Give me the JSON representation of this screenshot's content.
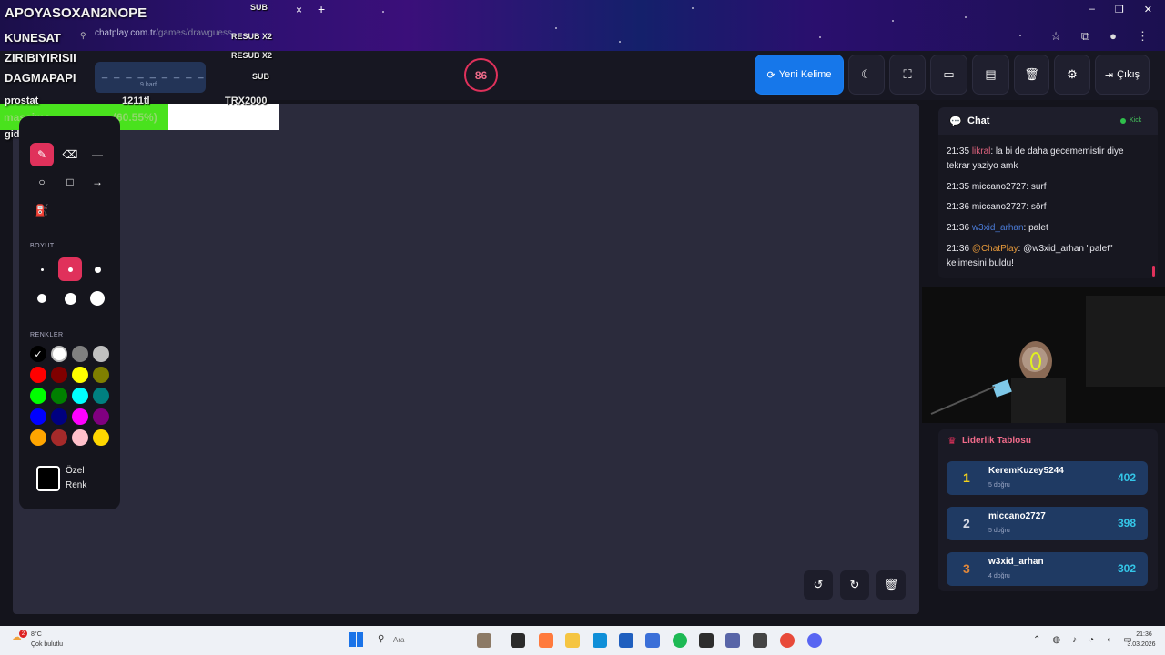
{
  "browser": {
    "tab_close": "×",
    "tab_new": "+",
    "url_domain": "chatplay.com.tr",
    "url_path": "/games/drawguess",
    "window_controls": [
      "–",
      "❐",
      "✕"
    ]
  },
  "overlay": {
    "names": [
      "APOYASOXAN2NOPE",
      "KUNESAT",
      "ZIRIBIYIRISII",
      "DAGMAPAPI",
      "prostat",
      "gidicem"
    ],
    "tags": [
      "SUB",
      "RESUB X2",
      "RESUB X2",
      "SUB",
      "1211tl",
      "TRX2000"
    ],
    "bar_word": "masajma",
    "bar_percent": "(60.55%)",
    "bar_fill": 0.6055
  },
  "header": {
    "timer": "86",
    "word_hint": "_ _ _ _ _ _ _ _ _",
    "word_count": "9 harf",
    "new_word_label": "Yeni Kelime",
    "exit_label": "Çıkış"
  },
  "tools": {
    "size_label": "BOYUT",
    "colors_label": "RENKLER",
    "custom_color_label": "Özel Renk",
    "check_mark": "✓",
    "colors": [
      "#000000",
      "#ffffff",
      "#808080",
      "#c0c0c0",
      "#ff0000",
      "#800000",
      "#ffff00",
      "#808000",
      "#00ff00",
      "#008000",
      "#00ffff",
      "#008080",
      "#0000ff",
      "#000080",
      "#ff00ff",
      "#800080",
      "#ffa500",
      "#a52a2a",
      "#ffc0cb",
      "#ffd700"
    ]
  },
  "chat": {
    "title": "Chat",
    "source": "Kick",
    "messages": [
      {
        "time": "21:35",
        "user": "likral",
        "text": ": la bi de daha gecememistir diye tekrar yaziyo amk"
      },
      {
        "time": "21:35",
        "user": "miccano2727",
        "text": ": surf"
      },
      {
        "time": "21:36",
        "user": "miccano2727",
        "text": ": sörf"
      },
      {
        "time": "21:36",
        "user": "w3xid_arhan",
        "text": ": palet"
      },
      {
        "time": "21:36",
        "user": "@ChatPlay",
        "text": ": @w3xid_arhan \"palet\" kelimesini buldu!"
      }
    ]
  },
  "leaderboard": {
    "title": "Liderlik Tablosu",
    "rows": [
      {
        "rank": "1",
        "name": "KeremKuzey5244",
        "sub": "5 doğru",
        "score": "402"
      },
      {
        "rank": "2",
        "name": "miccano2727",
        "sub": "5 doğru",
        "score": "398"
      },
      {
        "rank": "3",
        "name": "w3xid_arhan",
        "sub": "4 doğru",
        "score": "302"
      }
    ]
  },
  "taskbar": {
    "weather_badge": "2",
    "temperature": "8°C",
    "weather_desc": "Çok bulutlu",
    "search_placeholder": "Ara",
    "time": "21:36",
    "date": "3.03.2026"
  }
}
